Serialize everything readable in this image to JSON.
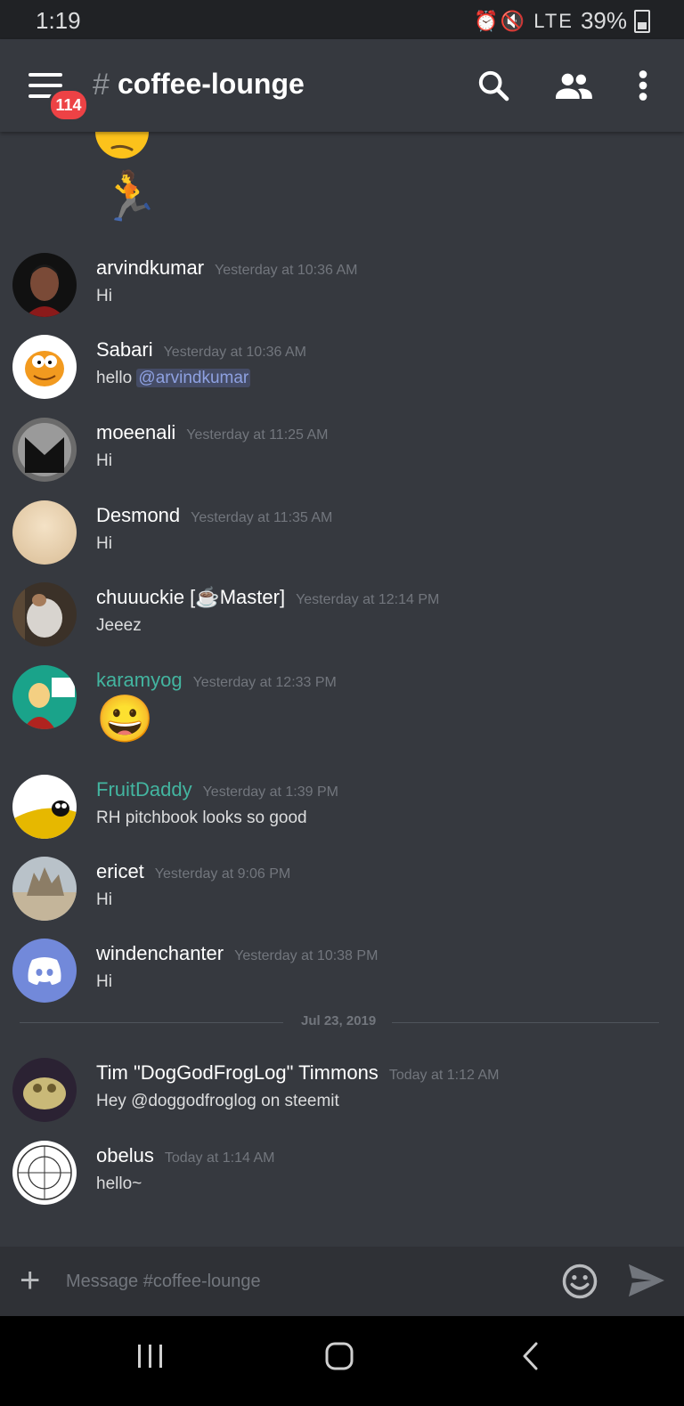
{
  "status_bar": {
    "time": "1:19",
    "icons": "⏰🔇 LTE",
    "battery": "39%"
  },
  "header": {
    "menu_badge": "114",
    "hash": "#",
    "channel_name": "coffee-lounge",
    "icons": [
      "hamburger-icon",
      "search-icon",
      "members-icon",
      "more-vertical-icon"
    ]
  },
  "messages": [
    {
      "username": "arvindkumar",
      "timestamp": "Yesterday at 10:36 AM",
      "text": "Hi"
    },
    {
      "username": "Sabari",
      "timestamp": "Yesterday at 10:36 AM",
      "text_prefix": "hello ",
      "mention": "@arvindkumar"
    },
    {
      "username": "moeenali",
      "timestamp": "Yesterday at 11:25 AM",
      "text": "Hi"
    },
    {
      "username": "Desmond",
      "timestamp": "Yesterday at 11:35 AM",
      "text": "Hi"
    },
    {
      "username_prefix": "chuuuckie [",
      "username_emoji": "☕",
      "username_suffix": "Master]",
      "timestamp": "Yesterday at 12:14 PM",
      "text": "Jeeez"
    },
    {
      "username": "karamyog",
      "timestamp": "Yesterday at 12:33 PM",
      "emoji": "😀"
    },
    {
      "username": "FruitDaddy",
      "timestamp": "Yesterday at 1:39 PM",
      "text": "RH pitchbook looks so good"
    },
    {
      "username": "ericet",
      "timestamp": "Yesterday at 9:06 PM",
      "text": "Hi"
    },
    {
      "username": "windenchanter",
      "timestamp": "Yesterday at 10:38 PM",
      "text": "Hi"
    },
    {
      "username": "Tim \"DogGodFrogLog\" Timmons",
      "timestamp": "Today at 1:12 AM",
      "text": "Hey @doggodfroglog on steemit"
    },
    {
      "username": "obelus",
      "timestamp": "Today at 1:14 AM",
      "text": "hello~"
    }
  ],
  "top_emojis": [
    "🙄",
    "🏃"
  ],
  "date_divider": "Jul 23, 2019",
  "composer": {
    "placeholder": "Message #coffee-lounge"
  },
  "colors": {
    "background": "#36393f",
    "mention": "#8ea1e1",
    "role_teal": "#43b5a0",
    "badge_red": "#ed4245",
    "blurple": "#7289da"
  }
}
